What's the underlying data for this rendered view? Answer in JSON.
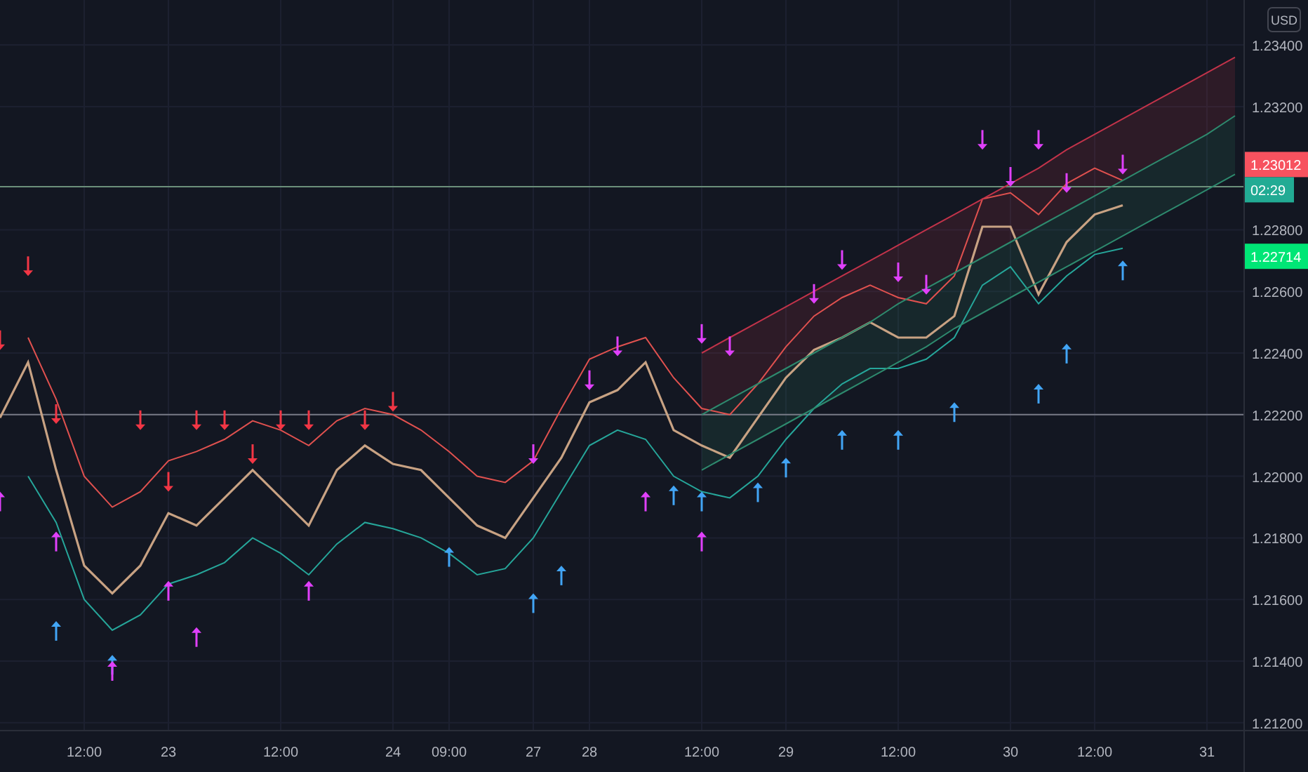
{
  "chart": {
    "currency": "USD",
    "chart_data": {
      "type": "line",
      "grid": true,
      "categories": [
        null,
        null,
        null,
        "12:00",
        null,
        null,
        "23",
        null,
        null,
        null,
        "12:00",
        null,
        null,
        null,
        "24",
        null,
        "09:00",
        null,
        null,
        "27",
        null,
        "28",
        null,
        null,
        null,
        "12:00",
        null,
        null,
        "29",
        null,
        null,
        null,
        "12:00",
        null,
        null,
        null,
        "30",
        null,
        null,
        "12:00",
        null,
        null,
        null,
        "31",
        null
      ],
      "series": [
        {
          "color": "#c8a283",
          "values": [
            1.2219,
            1.2237,
            1.2202,
            1.2171,
            1.2162,
            1.2171,
            1.2188,
            1.2184,
            1.2193,
            1.2202,
            1.2193,
            1.2184,
            1.2202,
            1.221,
            1.2204,
            1.2202,
            1.2193,
            1.2184,
            1.218,
            1.2193,
            1.2206,
            1.2224,
            1.2228,
            1.2237,
            1.2215,
            1.221,
            1.2206,
            1.2219,
            1.2232,
            1.2241,
            1.2245,
            1.225,
            1.2245,
            1.2245,
            1.2252,
            1.2281,
            1.2281,
            1.2259,
            1.2276,
            1.2285,
            1.2288,
            null,
            null,
            null,
            null
          ]
        },
        {
          "color": "#e0514f",
          "values": [
            null,
            1.2245,
            1.2225,
            1.22,
            1.219,
            1.2195,
            1.2205,
            1.2208,
            1.2212,
            1.2218,
            1.2215,
            1.221,
            1.2218,
            1.2222,
            1.222,
            1.2215,
            1.2208,
            1.22,
            1.2198,
            1.2205,
            1.2222,
            1.2238,
            1.2242,
            1.2245,
            1.2232,
            1.2222,
            1.222,
            1.223,
            1.2242,
            1.2252,
            1.2258,
            1.2262,
            1.2258,
            1.2256,
            1.2265,
            1.229,
            1.2292,
            1.2285,
            1.2295,
            1.23,
            1.2296,
            null,
            null,
            null,
            null
          ]
        },
        {
          "color": "#26a69a",
          "values": [
            null,
            1.22,
            1.2185,
            1.216,
            1.215,
            1.2155,
            1.2165,
            1.2168,
            1.2172,
            1.218,
            1.2175,
            1.2168,
            1.2178,
            1.2185,
            1.2183,
            1.218,
            1.2175,
            1.2168,
            1.217,
            1.218,
            1.2195,
            1.221,
            1.2215,
            1.2212,
            1.22,
            1.2195,
            1.2193,
            1.22,
            1.2212,
            1.2222,
            1.223,
            1.2235,
            1.2235,
            1.2238,
            1.2245,
            1.2262,
            1.2268,
            1.2256,
            1.2265,
            1.2272,
            1.2274,
            null,
            null,
            null,
            null
          ]
        },
        {
          "color": "#c2334a",
          "values": [
            null,
            null,
            null,
            null,
            null,
            null,
            null,
            null,
            null,
            null,
            null,
            null,
            null,
            null,
            null,
            null,
            null,
            null,
            null,
            null,
            null,
            null,
            null,
            null,
            null,
            1.224,
            1.2245,
            1.225,
            1.2255,
            1.226,
            1.2265,
            1.227,
            1.2275,
            1.228,
            1.2285,
            1.229,
            1.2295,
            1.23,
            1.2306,
            1.2311,
            1.2316,
            1.2321,
            1.2326,
            1.2331,
            1.2336
          ]
        },
        {
          "color": "#2e8a6e",
          "values": [
            null,
            null,
            null,
            null,
            null,
            null,
            null,
            null,
            null,
            null,
            null,
            null,
            null,
            null,
            null,
            null,
            null,
            null,
            null,
            null,
            null,
            null,
            null,
            null,
            null,
            1.222,
            1.2225,
            1.223,
            1.2235,
            1.224,
            1.2245,
            1.225,
            1.2256,
            1.2261,
            1.2266,
            1.2271,
            1.2276,
            1.2281,
            1.2286,
            1.2291,
            1.2296,
            1.2301,
            1.2306,
            1.2311,
            1.2317
          ]
        },
        {
          "color": "#2e8a6e",
          "values": [
            null,
            null,
            null,
            null,
            null,
            null,
            null,
            null,
            null,
            null,
            null,
            null,
            null,
            null,
            null,
            null,
            null,
            null,
            null,
            null,
            null,
            null,
            null,
            null,
            null,
            1.2202,
            1.2207,
            1.2212,
            1.2217,
            1.2222,
            1.2227,
            1.2232,
            1.2237,
            1.2242,
            1.2248,
            1.2253,
            1.2258,
            1.2263,
            1.2268,
            1.2273,
            1.2278,
            1.2283,
            1.2288,
            1.2293,
            1.2298
          ]
        },
        {
          "color": "#f23645",
          "marker": "triangle",
          "values": [
            1.2241,
            null,
            1.2217,
            null,
            null,
            null,
            1.2195,
            null,
            1.2215,
            null,
            1.2215,
            null,
            null,
            null,
            1.2221,
            null,
            null,
            null,
            null,
            null,
            null,
            null,
            null,
            null,
            null,
            null,
            null,
            null,
            null,
            null,
            null,
            null,
            null,
            null,
            null,
            null,
            null,
            null,
            null,
            null,
            null,
            null,
            null,
            null,
            null
          ]
        },
        {
          "color": "#f23645",
          "marker": "triangle",
          "values": [
            null,
            1.2265,
            null,
            null,
            null,
            1.2215,
            null,
            1.2215,
            null,
            1.2204,
            null,
            1.2215,
            null,
            1.2215,
            null,
            null,
            null,
            null,
            null,
            null,
            null,
            null,
            null,
            null,
            null,
            null,
            null,
            null,
            null,
            null,
            null,
            null,
            null,
            null,
            null,
            null,
            null,
            null,
            null,
            null,
            null,
            null,
            null,
            null,
            null
          ]
        },
        {
          "color": "#e040fb",
          "marker": "triangle",
          "values": [
            null,
            null,
            null,
            null,
            null,
            null,
            null,
            null,
            null,
            null,
            null,
            null,
            null,
            null,
            null,
            null,
            null,
            null,
            null,
            null,
            null,
            null,
            1.2239,
            null,
            null,
            null,
            1.2239,
            null,
            null,
            null,
            1.2267,
            null,
            1.2263,
            null,
            null,
            null,
            1.2294,
            null,
            1.2292,
            null,
            1.2298,
            null,
            null,
            null,
            null
          ]
        },
        {
          "color": "#e040fb",
          "marker": "triangle",
          "values": [
            null,
            null,
            null,
            null,
            null,
            null,
            null,
            null,
            null,
            null,
            null,
            null,
            null,
            null,
            null,
            null,
            null,
            null,
            null,
            1.2204,
            null,
            1.2228,
            null,
            null,
            null,
            1.2243,
            null,
            null,
            null,
            1.2256,
            null,
            null,
            null,
            1.2259,
            null,
            1.2306,
            null,
            1.2306,
            null,
            null,
            null,
            null,
            null,
            null,
            null
          ]
        },
        {
          "color": "#42a5f5",
          "marker": "triangle",
          "values": [
            null,
            null,
            1.2153,
            null,
            1.2142,
            null,
            null,
            null,
            null,
            null,
            null,
            null,
            null,
            null,
            null,
            null,
            1.2177,
            null,
            null,
            null,
            1.2171,
            null,
            null,
            null,
            1.2197,
            null,
            null,
            null,
            1.2206,
            null,
            1.2215,
            null,
            1.2215,
            null,
            1.2224,
            null,
            null,
            null,
            1.2243,
            null,
            1.227,
            null,
            null,
            null,
            null
          ]
        },
        {
          "color": "#42a5f5",
          "marker": "triangle",
          "values": [
            null,
            null,
            null,
            null,
            null,
            null,
            null,
            null,
            null,
            null,
            null,
            null,
            null,
            null,
            null,
            null,
            null,
            null,
            null,
            1.2162,
            null,
            null,
            null,
            null,
            null,
            1.2195,
            null,
            1.2198,
            null,
            null,
            null,
            null,
            null,
            null,
            null,
            null,
            null,
            1.223,
            null,
            null,
            null,
            null,
            null,
            null,
            null
          ]
        },
        {
          "color": "#e040fb",
          "marker": "triangle",
          "values": [
            1.2195,
            null,
            1.2182,
            null,
            1.214,
            null,
            1.2166,
            null,
            null,
            null,
            null,
            null,
            null,
            null,
            null,
            null,
            null,
            null,
            null,
            null,
            null,
            null,
            null,
            null,
            null,
            null,
            null,
            null,
            null,
            null,
            null,
            null,
            null,
            null,
            null,
            null,
            null,
            null,
            null,
            null,
            null,
            null,
            null,
            null,
            null
          ]
        },
        {
          "color": "#e040fb",
          "marker": "triangle",
          "values": [
            null,
            null,
            null,
            null,
            null,
            null,
            null,
            1.2151,
            null,
            null,
            null,
            1.2166,
            null,
            null,
            null,
            null,
            null,
            null,
            null,
            null,
            null,
            null,
            null,
            1.2195,
            null,
            1.2182,
            null,
            null,
            null,
            null,
            null,
            null,
            null,
            null,
            null,
            null,
            null,
            null,
            null,
            null,
            null,
            null,
            null,
            null,
            null
          ]
        }
      ],
      "ref_lines": [
        {
          "axis": "y",
          "value": 1.2294,
          "color": "#6b8f7a"
        },
        {
          "axis": "y",
          "value": 1.222,
          "color": "#787b86"
        }
      ],
      "annotations": [
        "1.23012",
        "02:29",
        "1.22714"
      ],
      "ylim": [
        1.2104,
        1.23546
      ],
      "yticks": [
        {
          "value": 1.234,
          "label": "1.23400"
        },
        {
          "value": 1.232,
          "label": "1.23200"
        },
        {
          "value": 1.228,
          "label": "1.22800"
        },
        {
          "value": 1.226,
          "label": "1.22600"
        },
        {
          "value": 1.224,
          "label": "1.22400"
        },
        {
          "value": 1.222,
          "label": "1.22200"
        },
        {
          "value": 1.22,
          "label": "1.22000"
        },
        {
          "value": 1.218,
          "label": "1.21800"
        },
        {
          "value": 1.216,
          "label": "1.21600"
        },
        {
          "value": 1.214,
          "label": "1.21400"
        },
        {
          "value": 1.212,
          "label": "1.21200"
        }
      ]
    }
  }
}
